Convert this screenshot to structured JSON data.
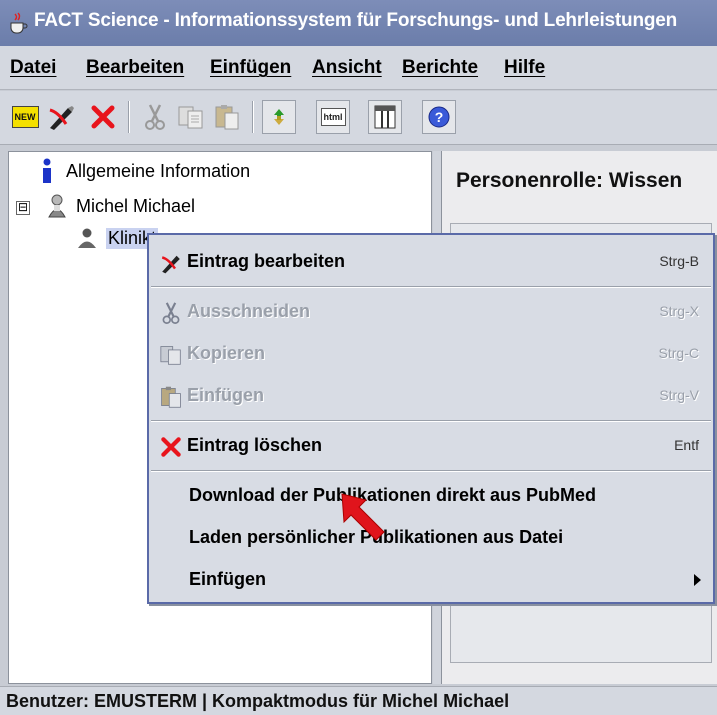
{
  "window": {
    "title": "FACT Science - Informationssystem für Forschungs- und Lehrleistungen"
  },
  "menubar": {
    "items": [
      "Datei",
      "Bearbeiten",
      "Einfügen",
      "Ansicht",
      "Berichte",
      "Hilfe"
    ]
  },
  "toolbar": {
    "new_label": "NEW",
    "html_label": "html",
    "icons": [
      "new-icon",
      "edit-icon",
      "delete-icon",
      "cut-icon",
      "copy-icon",
      "paste-icon",
      "refresh-icon",
      "html-icon",
      "columns-icon",
      "help-icon"
    ]
  },
  "tree": {
    "items": [
      {
        "label": "Allgemeine Information",
        "icon": "info-icon"
      },
      {
        "label": "Michel Michael",
        "icon": "person-icon",
        "expander": "⊟"
      },
      {
        "label": "Klinikt",
        "icon": "user-role-icon",
        "selected": true
      }
    ]
  },
  "right_panel": {
    "title": "Personenrolle: Wissen"
  },
  "context_menu": {
    "items": [
      {
        "label": "Eintrag bearbeiten",
        "shortcut": "Strg-B",
        "icon": "edit-icon",
        "enabled": true
      },
      {
        "label": "Ausschneiden",
        "shortcut": "Strg-X",
        "icon": "cut-icon",
        "enabled": false
      },
      {
        "label": "Kopieren",
        "shortcut": "Strg-C",
        "icon": "copy-icon",
        "enabled": false
      },
      {
        "label": "Einfügen",
        "shortcut": "Strg-V",
        "icon": "paste-icon",
        "enabled": false
      },
      {
        "label": "Eintrag löschen",
        "shortcut": "Entf",
        "icon": "delete-icon",
        "enabled": true
      },
      {
        "label": "Download der Publikationen direkt aus PubMed",
        "enabled": true
      },
      {
        "label": "Laden persönlicher Publikationen aus Datei",
        "enabled": true
      },
      {
        "label": "Einfügen",
        "enabled": true,
        "submenu": true
      }
    ]
  },
  "statusbar": {
    "text": "Benutzer: EMUSTERM | Kompaktmodus für Michel Michael"
  },
  "colors": {
    "titlebar": "#6b7daa",
    "menu_border": "#5a6aa8",
    "delete_red": "#e8141c",
    "info_blue": "#1c34c8",
    "cursor_red": "#e0141c"
  }
}
